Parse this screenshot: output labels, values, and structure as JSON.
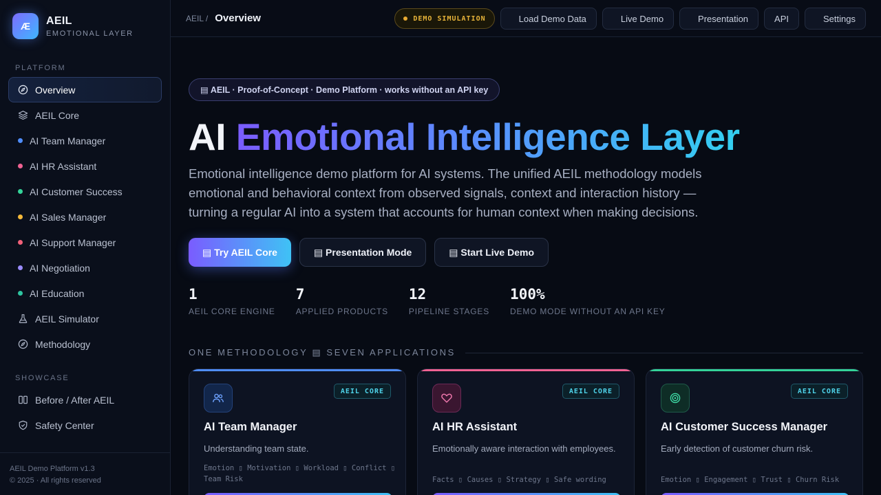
{
  "brand": {
    "logo": "Æ",
    "name": "AEIL",
    "subtitle": "EMOTIONAL LAYER"
  },
  "sidebar": {
    "platform_label": "PLATFORM",
    "platform_items": [
      {
        "label": "Overview",
        "icon": "compass-icon",
        "active": true
      },
      {
        "label": "AEIL Core",
        "icon": "layers-icon"
      },
      {
        "label": "AI Team Manager",
        "dot": "#4f8dfb"
      },
      {
        "label": "AI HR Assistant",
        "dot": "#f06292"
      },
      {
        "label": "AI Customer Success",
        "dot": "#34d399"
      },
      {
        "label": "AI Sales Manager",
        "dot": "#f5b93a"
      },
      {
        "label": "AI Support Manager",
        "dot": "#f2617a"
      },
      {
        "label": "AI Negotiation",
        "dot": "#9b8cff"
      },
      {
        "label": "AI Education",
        "dot": "#2ec4a0"
      },
      {
        "label": "AEIL Simulator",
        "icon": "flask-icon"
      },
      {
        "label": "Methodology",
        "icon": "compass-icon"
      }
    ],
    "showcase_label": "SHOWCASE",
    "showcase_items": [
      {
        "label": "Before / After AEIL",
        "icon": "columns-icon"
      },
      {
        "label": "Safety Center",
        "icon": "shield-icon"
      }
    ],
    "footer": {
      "version": "AEIL Demo Platform v1.3",
      "copyright": "© 2025 · All rights reserved"
    }
  },
  "topbar": {
    "breadcrumb_parent": "AEIL /",
    "breadcrumb_current": "Overview",
    "demo_badge": "DEMO SIMULATION",
    "buttons": [
      "Load Demo Data",
      "Live Demo",
      "Presentation",
      "API",
      "Settings"
    ]
  },
  "hero": {
    "pill": "▤ AEIL · Proof-of-Concept · Demo Platform · works without an API key",
    "title_plain": "AI",
    "title_gradient": "Emotional Intelligence Layer",
    "description": "Emotional intelligence demo platform for AI systems. The unified AEIL methodology models emotional and behavioral context from observed signals, context and interaction history — turning a regular AI into a system that accounts for human context when making decisions.",
    "cta_primary": "▤ Try AEIL Core",
    "cta_presentation": "▤ Presentation Mode",
    "cta_live": "▤ Start Live Demo"
  },
  "stats": [
    {
      "value": "1",
      "label": "AEIL CORE ENGINE"
    },
    {
      "value": "7",
      "label": "APPLIED PRODUCTS"
    },
    {
      "value": "12",
      "label": "PIPELINE STAGES"
    },
    {
      "value": "100%",
      "label": "DEMO MODE WITHOUT AN API KEY"
    }
  ],
  "section_heading": "ONE METHODOLOGY ▤ SEVEN APPLICATIONS",
  "cards": [
    {
      "title": "AI Team Manager",
      "badge": "AEIL CORE",
      "description": "Understanding team state.",
      "tags": "Emotion ▯ Motivation ▯ Workload ▯ Conflict ▯ Team Risk",
      "accent": "#4f8dfb",
      "icon": "users-icon"
    },
    {
      "title": "AI HR Assistant",
      "badge": "AEIL CORE",
      "description": "Emotionally aware interaction with employees.",
      "tags": "Facts ▯ Causes ▯ Strategy ▯ Safe wording",
      "accent": "#f06292",
      "icon": "heart-icon"
    },
    {
      "title": "AI Customer Success Manager",
      "badge": "AEIL CORE",
      "description": "Early detection of customer churn risk.",
      "tags": "Emotion ▯ Engagement ▯ Trust ▯ Churn Risk",
      "accent": "#34d399",
      "icon": "target-icon"
    }
  ]
}
